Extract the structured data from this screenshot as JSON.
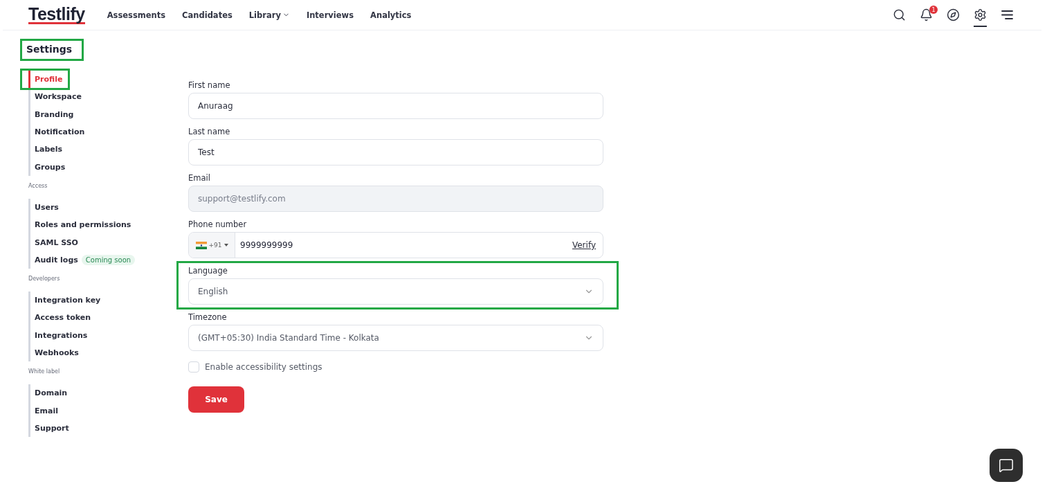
{
  "logo": "Testlify",
  "nav": [
    {
      "label": "Assessments",
      "dropdown": false
    },
    {
      "label": "Candidates",
      "dropdown": false
    },
    {
      "label": "Library",
      "dropdown": true
    },
    {
      "label": "Interviews",
      "dropdown": false
    },
    {
      "label": "Analytics",
      "dropdown": false
    }
  ],
  "notification_count": "1",
  "header_icons": [
    {
      "kind": "search",
      "selected": false
    },
    {
      "kind": "bell",
      "selected": false
    },
    {
      "kind": "compass",
      "selected": false
    },
    {
      "kind": "settings",
      "selected": true
    },
    {
      "kind": "menu",
      "selected": false
    }
  ],
  "page_title": {
    "text": "Settings",
    "highlighted": true
  },
  "sidebar": [
    {
      "items": [
        {
          "label": "Profile",
          "selected": true,
          "highlighted": true
        },
        {
          "label": "Workspace",
          "selected": false,
          "highlighted": false
        },
        {
          "label": "Branding",
          "selected": false,
          "highlighted": false
        },
        {
          "label": "Notification",
          "selected": false,
          "highlighted": false
        },
        {
          "label": "Labels",
          "selected": false,
          "highlighted": false
        },
        {
          "label": "Groups",
          "selected": false,
          "highlighted": false
        }
      ]
    },
    {
      "heading": "Access",
      "items": [
        {
          "label": "Users",
          "selected": false,
          "highlighted": false
        },
        {
          "label": "Roles and permissions",
          "selected": false,
          "highlighted": false
        },
        {
          "label": "SAML SSO",
          "selected": false,
          "highlighted": false
        },
        {
          "label": "Audit logs",
          "badge": "Coming soon",
          "selected": false,
          "highlighted": false
        }
      ]
    },
    {
      "heading": "Developers",
      "items": [
        {
          "label": "Integration key",
          "selected": false,
          "highlighted": false
        },
        {
          "label": "Access token",
          "selected": false,
          "highlighted": false
        },
        {
          "label": "Integrations",
          "selected": false,
          "highlighted": false
        },
        {
          "label": "Webhooks",
          "selected": false,
          "highlighted": false
        }
      ]
    },
    {
      "heading": "White label",
      "items": [
        {
          "label": "Domain",
          "selected": false,
          "highlighted": false
        },
        {
          "label": "Email",
          "selected": false,
          "highlighted": false
        },
        {
          "label": "Support",
          "selected": false,
          "highlighted": false
        }
      ]
    }
  ],
  "form": [
    {
      "kind": "text",
      "label": "First name",
      "value": "Anuraag",
      "disabled": false,
      "highlighted": false
    },
    {
      "kind": "text",
      "label": "Last name",
      "value": "Test",
      "disabled": false,
      "highlighted": false
    },
    {
      "kind": "text",
      "label": "Email",
      "value": "support@testlify.com",
      "disabled": true,
      "highlighted": false
    },
    {
      "kind": "phone",
      "label": "Phone number",
      "code": "+91",
      "value": "9999999999",
      "action": "Verify",
      "highlighted": false
    },
    {
      "kind": "select",
      "label": "Language",
      "value": "English",
      "highlighted": true
    },
    {
      "kind": "select",
      "label": "Timezone",
      "value": "(GMT+05:30) India Standard Time - Kolkata",
      "highlighted": false
    }
  ],
  "accessibility": {
    "label": "Enable accessibility settings",
    "checked": false
  },
  "save_button": "Save"
}
